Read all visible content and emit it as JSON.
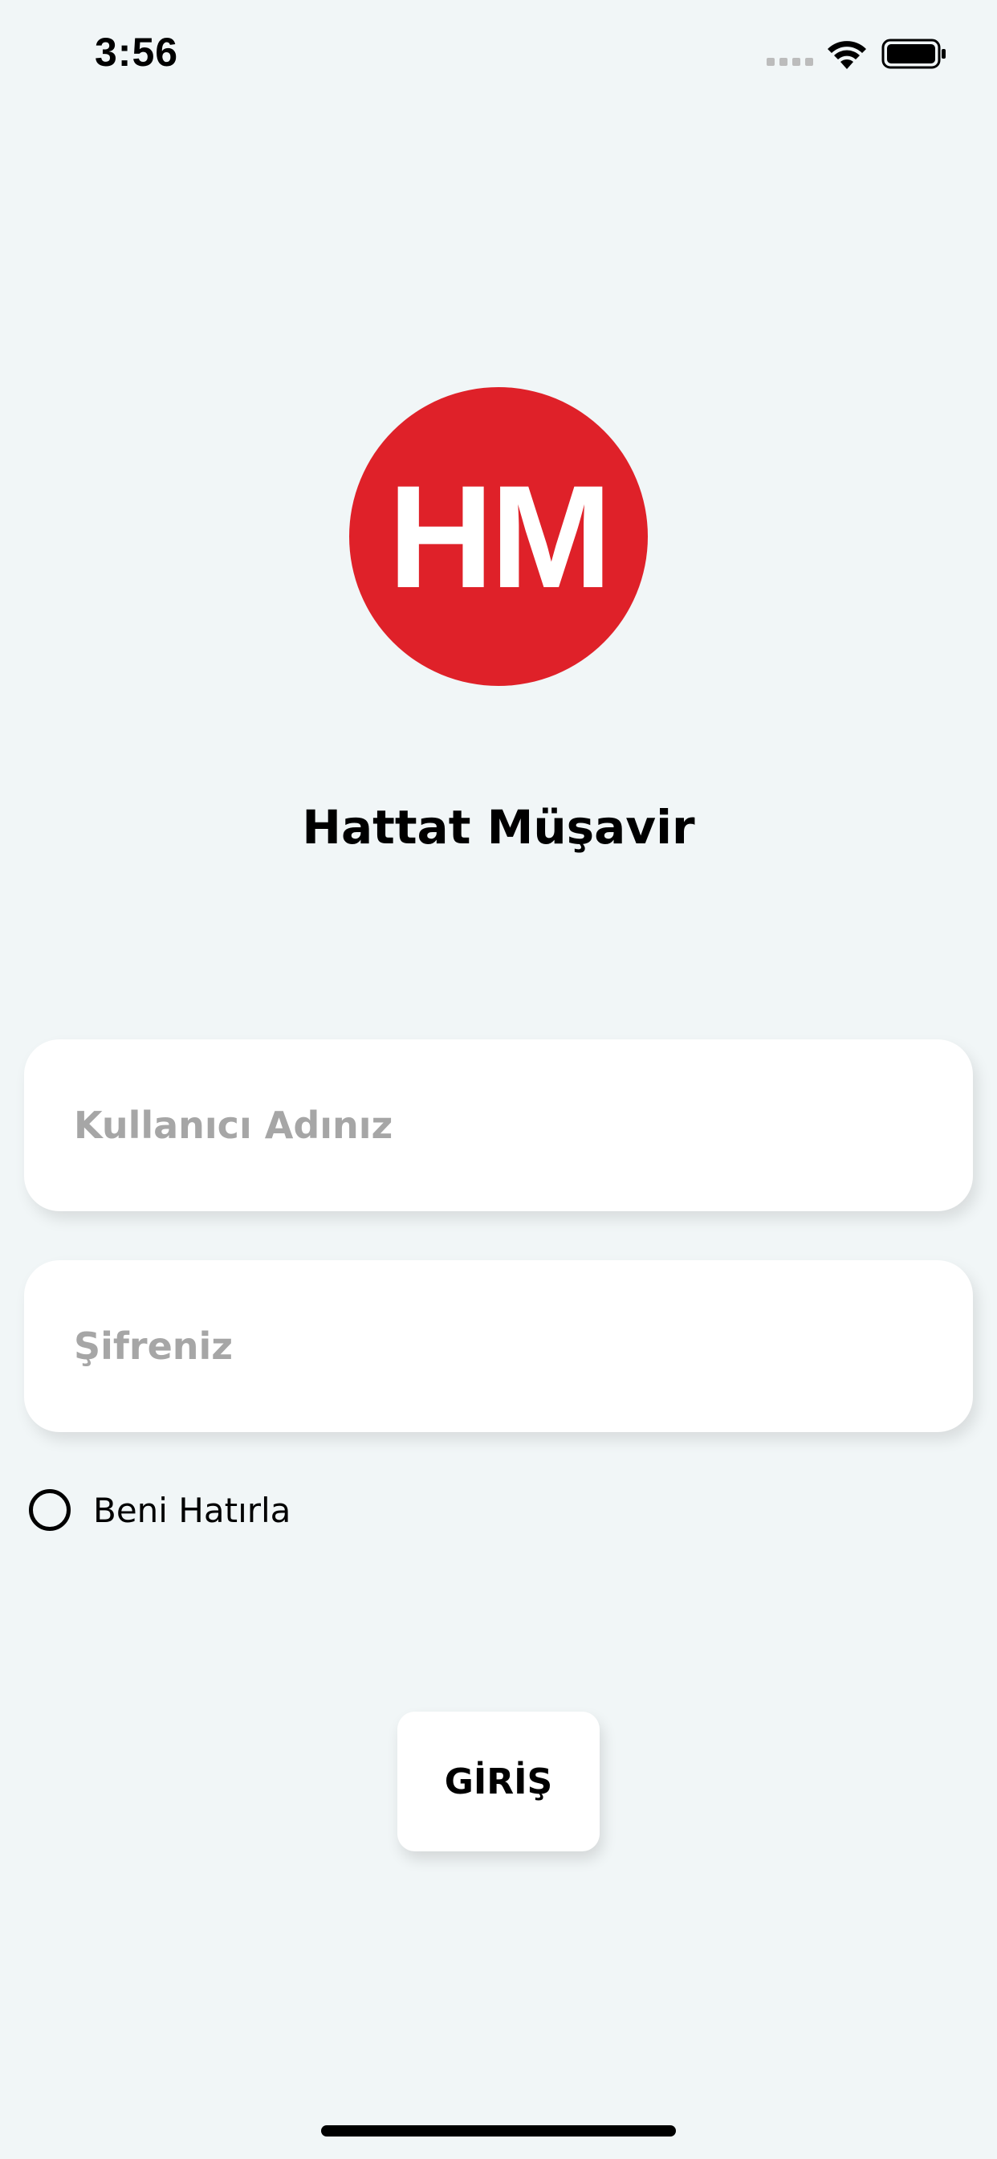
{
  "status_bar": {
    "time": "3:56"
  },
  "logo": {
    "text": "HM",
    "color": "#df2129"
  },
  "app": {
    "title": "Hattat Müşavir"
  },
  "login_form": {
    "username": {
      "placeholder": "Kullanıcı Adınız",
      "value": ""
    },
    "password": {
      "placeholder": "Şifreniz",
      "value": ""
    },
    "remember_me": {
      "label": "Beni Hatırla",
      "checked": false
    },
    "submit_label": "GİRİŞ"
  },
  "icons": {
    "wifi": "wifi-icon",
    "battery": "battery-icon",
    "signal": "cellular-signal-icon",
    "radio": "radio-unchecked-icon"
  }
}
